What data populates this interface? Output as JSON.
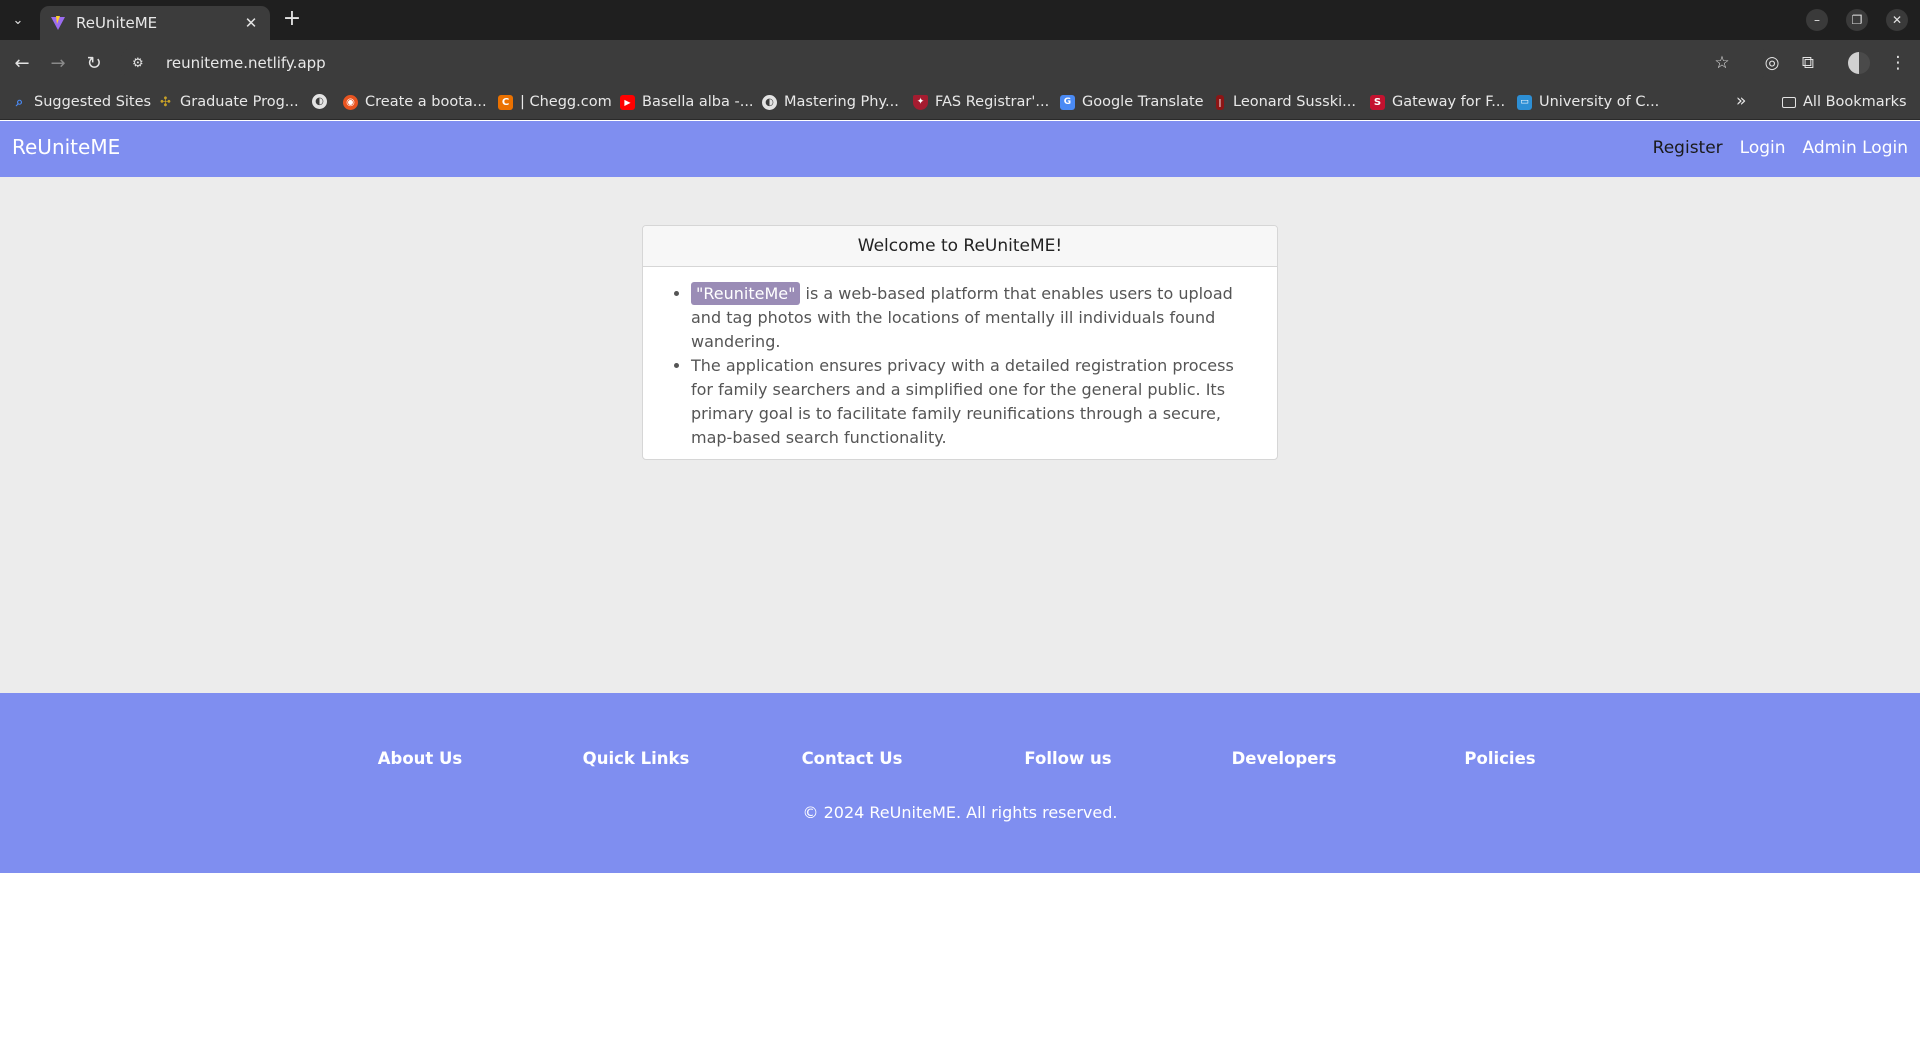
{
  "browser": {
    "tab_title": "ReUniteME",
    "url": "reuniteme.netlify.app",
    "bookmarks": [
      {
        "label": "Suggested Sites",
        "icon": "search-icon",
        "color": "#4a8af4"
      },
      {
        "label": "Graduate Prog...",
        "icon": "dots-icon",
        "color": "#c9a227"
      },
      {
        "label": "",
        "icon": "globe-icon",
        "color": "#e3e3e3"
      },
      {
        "label": "Create a boota...",
        "icon": "ubuntu-icon",
        "color": "#e95420"
      },
      {
        "label": "| Chegg.com",
        "icon": "chegg-icon",
        "color": "#eb7100"
      },
      {
        "label": "Basella alba -...",
        "icon": "youtube-icon",
        "color": "#ff0000"
      },
      {
        "label": "Mastering Phy...",
        "icon": "globe-icon",
        "color": "#e3e3e3"
      },
      {
        "label": "FAS Registrar'...",
        "icon": "shield-icon",
        "color": "#a51c30"
      },
      {
        "label": "Google Translate",
        "icon": "translate-icon",
        "color": "#4a8af4"
      },
      {
        "label": "Leonard Susski...",
        "icon": "torch-icon",
        "color": "#8c1515"
      },
      {
        "label": "Gateway for F...",
        "icon": "s-icon",
        "color": "#c4122f"
      },
      {
        "label": "University of C...",
        "icon": "uni-icon",
        "color": "#2d8fd5"
      }
    ],
    "all_bookmarks_label": "All Bookmarks"
  },
  "navbar": {
    "brand": "ReUniteME",
    "links": [
      "Register",
      "Login",
      "Admin Login"
    ]
  },
  "welcome_card": {
    "header": "Welcome to ReUniteME!",
    "highlight": "\"ReuniteMe\"",
    "item1_rest": " is a web-based platform that enables users to upload and tag photos with the locations of mentally ill individuals found wandering.",
    "item2": "The application ensures privacy with a detailed registration process for family searchers and a simplified one for the general public. Its primary goal is to facilitate family reunifications through a secure, map-based search functionality."
  },
  "footer": {
    "links": [
      "About Us",
      "Quick Links",
      "Contact Us",
      "Follow us",
      "Developers",
      "Policies"
    ],
    "copyright": "© 2024 ReUniteME. All rights reserved."
  }
}
